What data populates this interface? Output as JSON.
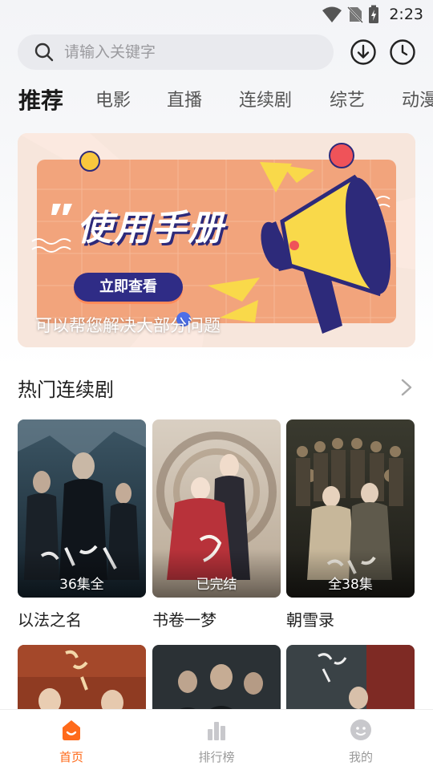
{
  "status_bar": {
    "time": "2:23"
  },
  "search": {
    "placeholder": "请输入关键字"
  },
  "tabs": [
    {
      "label": "推荐",
      "active": true
    },
    {
      "label": "电影",
      "active": false
    },
    {
      "label": "直播",
      "active": false
    },
    {
      "label": "连续剧",
      "active": false
    },
    {
      "label": "综艺",
      "active": false
    },
    {
      "label": "动漫",
      "active": false
    }
  ],
  "banner": {
    "title": "使用手册",
    "button": "立即查看",
    "caption": "可以帮您解决大部分问题"
  },
  "section": {
    "title": "热门连续剧"
  },
  "shows": [
    {
      "title": "以法之名",
      "status": "36集全"
    },
    {
      "title": "书卷一梦",
      "status": "已完结"
    },
    {
      "title": "朝雪录",
      "status": "全38集"
    }
  ],
  "bottom_nav": [
    {
      "label": "首页",
      "icon": "home-icon",
      "active": true
    },
    {
      "label": "排行榜",
      "icon": "ranking-icon",
      "active": false
    },
    {
      "label": "我的",
      "icon": "profile-icon",
      "active": false
    }
  ],
  "colors": {
    "accent": "#ff6a1a",
    "banner_button": "#2f2c86"
  }
}
